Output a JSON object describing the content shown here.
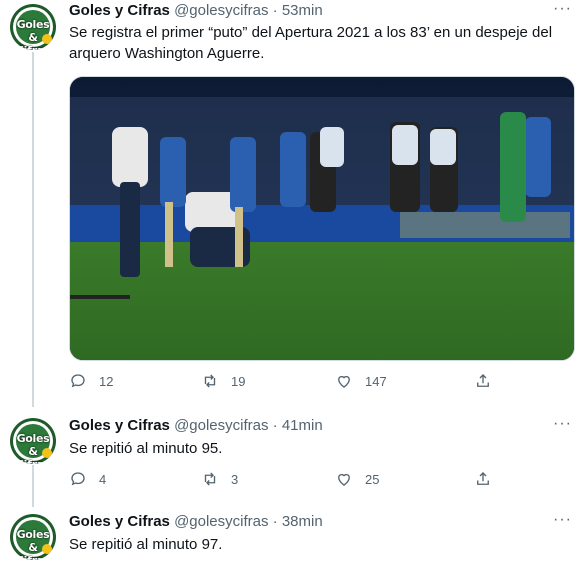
{
  "tweets": [
    {
      "name": "Goles y Cifras",
      "handle": "@golesycifras",
      "time": "53min",
      "text": "Se registra el primer “puto” del Apertura 2021 a los 83’ en un despeje del arquero Washington Aguerre.",
      "replies": "12",
      "retweets": "19",
      "likes": "147"
    },
    {
      "name": "Goles y Cifras",
      "handle": "@golesycifras",
      "time": "41min",
      "text": "Se repitió al minuto 95.",
      "replies": "4",
      "retweets": "3",
      "likes": "25"
    },
    {
      "name": "Goles y Cifras",
      "handle": "@golesycifras",
      "time": "38min",
      "text": "Se repitió al minuto 97."
    }
  ],
  "avatar_text": "Goles & Cifras",
  "separator": " · ",
  "more_label": "···",
  "colors": {
    "text": "#0f1419",
    "secondary": "#536471",
    "thread": "#cfd9de"
  }
}
